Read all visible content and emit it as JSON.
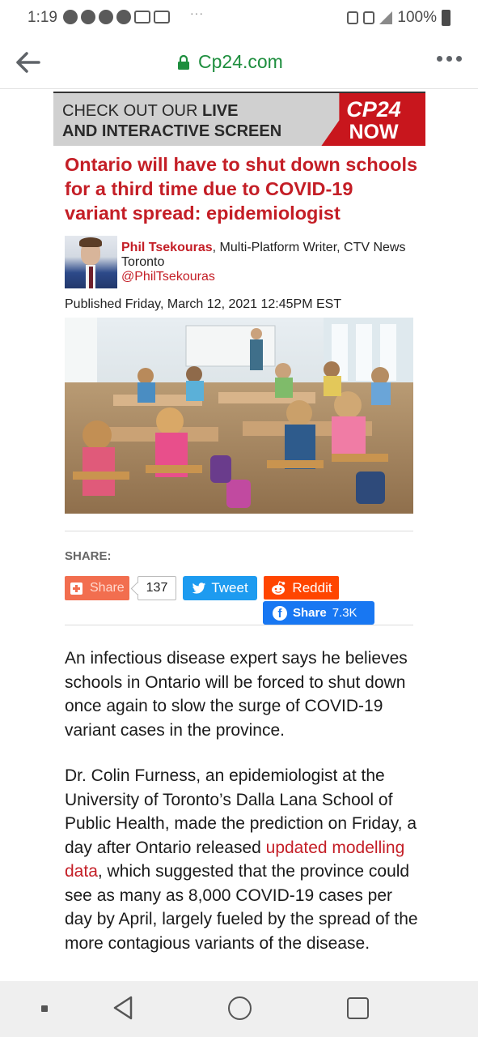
{
  "status_bar": {
    "time": "1:19",
    "notification_icons": [
      "facebook-icon",
      "facebook-icon",
      "app-icon",
      "spade-icon",
      "gallery-icon",
      "gmail-icon"
    ],
    "overflow": "···",
    "battery": "100%",
    "system_icons": [
      "bluetooth-icon",
      "nfc-icon",
      "vibrate-icon",
      "alarm-icon",
      "wifi-icon",
      "signal-icon",
      "battery-icon"
    ]
  },
  "browser": {
    "url": "Cp24.com",
    "url_color": "#1e8e3e"
  },
  "banner": {
    "line1_plain": "CHECK OUT OUR ",
    "line1_bold": "LIVE",
    "line2_bold": "AND INTERACTIVE SCREEN",
    "logo_top": "CP24",
    "logo_bottom": "NOW",
    "brand_color": "#c8161d"
  },
  "article": {
    "headline": "Ontario will have to shut down schools for a third time due to COVID-19 variant spread: epidemiologist",
    "author_name": "Phil Tsekouras",
    "author_role": ", Multi-Platform Writer, CTV News Toronto",
    "author_handle": "@PhilTsekouras",
    "published": "Published Friday, March 12, 2021 12:45PM EST",
    "accent_color": "#c41e26"
  },
  "share": {
    "label": "SHARE:",
    "share_button": "Share",
    "share_count": "137",
    "tweet_button": "Tweet",
    "reddit_button": "Reddit",
    "facebook_button": "Share",
    "facebook_count": "7.3K"
  },
  "body": {
    "p1": "An infectious disease expert says he believes schools in Ontario will be forced to shut down once again to slow the surge of COVID-19 variant cases in the province.",
    "p2_before": "Dr. Colin Furness, an epidemiologist at the University of Toronto’s Dalla Lana School of Public Health, made the prediction on Friday, a day after Ontario released ",
    "p2_link": "updated modelling data",
    "p2_after": ", which suggested that the province could see as many as 8,000 COVID-19 cases per day by April, largely fueled by the spread of the more contagious variants of the disease."
  }
}
